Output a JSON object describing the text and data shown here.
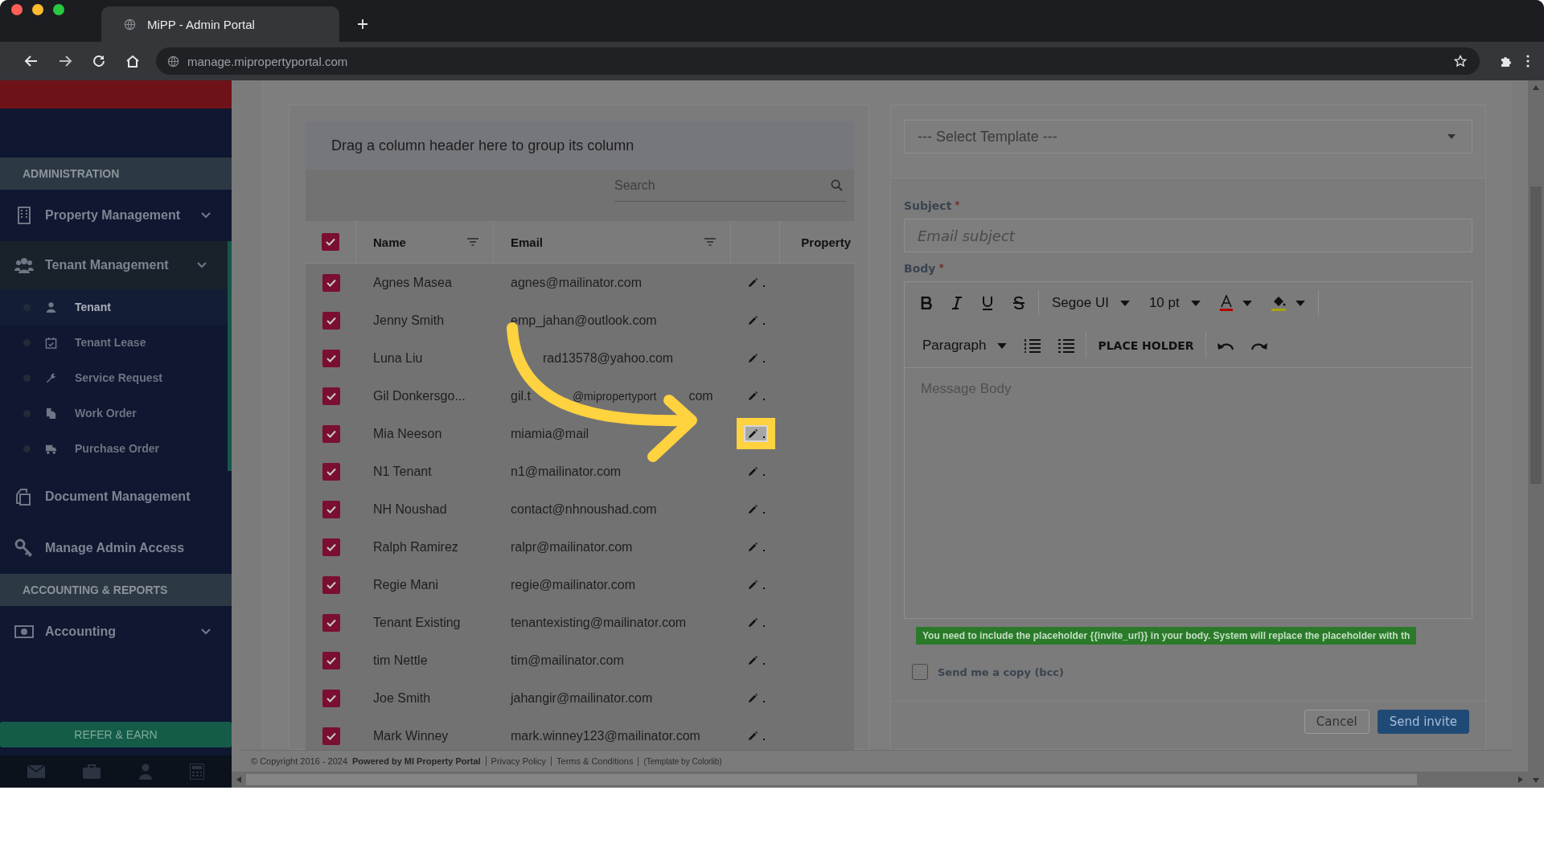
{
  "browser": {
    "tab_title": "MiPP - Admin Portal",
    "url": "manage.mipropertyportal.com"
  },
  "sidebar": {
    "sections": [
      {
        "title": "ADMINISTRATION",
        "items": [
          {
            "label": "Property Management",
            "expanded": false
          },
          {
            "label": "Tenant Management",
            "expanded": true,
            "children": [
              {
                "label": "Tenant",
                "selected": true
              },
              {
                "label": "Tenant Lease",
                "selected": false
              },
              {
                "label": "Service Request",
                "selected": false
              },
              {
                "label": "Work Order",
                "selected": false
              },
              {
                "label": "Purchase Order",
                "selected": false
              }
            ]
          },
          {
            "label": "Document Management"
          },
          {
            "label": "Manage Admin Access"
          }
        ]
      },
      {
        "title": "ACCOUNTING & REPORTS",
        "items": [
          {
            "label": "Accounting",
            "expanded": false
          }
        ]
      }
    ],
    "refer_button": "REFER & EARN"
  },
  "table": {
    "group_hint": "Drag a column header here to group its column",
    "search": {
      "placeholder": "Search"
    },
    "all_checked": true,
    "columns": [
      {
        "label": "Name"
      },
      {
        "label": "Email"
      },
      {
        "label": "Property"
      }
    ],
    "rows": [
      {
        "name": "Agnes Masea",
        "email": "agnes@mailinator.com",
        "checked": true,
        "highlighted": false
      },
      {
        "name": "Jenny Smith",
        "email": "emp_jahan@outlook.com",
        "checked": true,
        "highlighted": false
      },
      {
        "name": "Luna Liu",
        "email": "rad13578@yahoo.com",
        "checked": true,
        "highlighted": false
      },
      {
        "name": "Gil Donkersgo...",
        "email": "gil.t",
        "email_tail": "@mipropertyport",
        "email_end": "com",
        "checked": true,
        "highlighted": false
      },
      {
        "name": "Mia Neeson",
        "email": "miamia@mail",
        "checked": true,
        "highlighted": true
      },
      {
        "name": "N1 Tenant",
        "email": "n1@mailinator.com",
        "checked": true,
        "highlighted": false
      },
      {
        "name": "NH Noushad",
        "email": "contact@nhnoushad.com",
        "checked": true,
        "highlighted": false
      },
      {
        "name": "Ralph Ramirez",
        "email": "ralpr@mailinator.com",
        "checked": true,
        "highlighted": false
      },
      {
        "name": "Regie Mani",
        "email": "regie@mailinator.com",
        "checked": true,
        "highlighted": false
      },
      {
        "name": "Tenant Existing",
        "email": "tenantexisting@mailinator.com",
        "checked": true,
        "highlighted": false
      },
      {
        "name": "tim Nettle",
        "email": "tim@mailinator.com",
        "checked": true,
        "highlighted": false
      },
      {
        "name": "Joe Smith",
        "email": "jahangir@mailinator.com",
        "checked": true,
        "highlighted": false
      },
      {
        "name": "Mark Winney",
        "email": "mark.winney123@mailinator.com",
        "checked": true,
        "highlighted": false
      }
    ]
  },
  "form": {
    "template": {
      "placeholder": "--- Select Template ---"
    },
    "subject": {
      "label": "Subject",
      "required_mark": "*",
      "placeholder": "Email subject"
    },
    "body": {
      "label": "Body",
      "required_mark": "*",
      "placeholder": "Message Body"
    },
    "toolbar": {
      "font": "Segoe UI",
      "size": "10 pt",
      "block": "Paragraph",
      "placeholder_button": "PLACE HOLDER"
    },
    "notice": "You need to include the placeholder {{invite_url}} in your body. System will replace the placeholder with th",
    "bcc": {
      "label": "Send me a copy (bcc)",
      "checked": false
    },
    "buttons": [
      "Cancel",
      "Send invite"
    ]
  },
  "footer": {
    "copyright": "© Copyright 2016 - 2024",
    "powered": "Powered by MI Property Portal",
    "links": [
      "Privacy Policy",
      "Terms & Conditions"
    ],
    "credit": "(Template by Colorlib)"
  }
}
